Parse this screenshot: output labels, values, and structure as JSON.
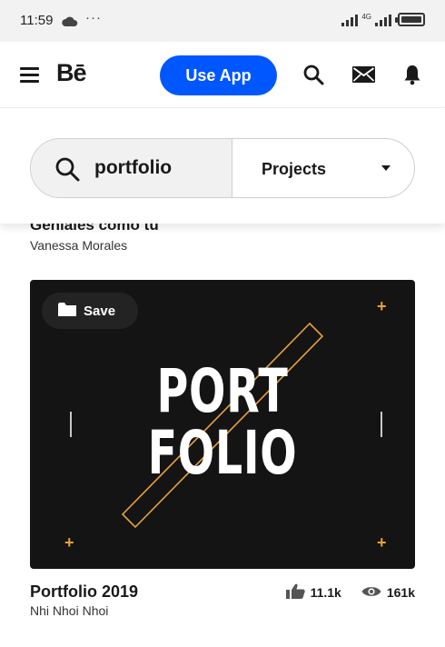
{
  "status_bar": {
    "time": "11:59",
    "dots": "···",
    "network_label": "4G"
  },
  "header": {
    "logo": "Bē",
    "use_app_label": "Use App"
  },
  "search": {
    "query": "portfolio",
    "filter_label": "Projects"
  },
  "previous_project": {
    "title": "Geniales como tú",
    "owner": "Vanessa Morales"
  },
  "project": {
    "save_label": "Save",
    "cover_word_line1": "PORT",
    "cover_word_line2": "FOLIO",
    "title": "Portfolio 2019",
    "owner": "Nhi Nhoi Nhoi",
    "appreciations": "11.1k",
    "views": "161k"
  },
  "colors": {
    "accent": "#0057ff",
    "cover_bg": "#141414",
    "cover_accent": "#e8a23a"
  }
}
